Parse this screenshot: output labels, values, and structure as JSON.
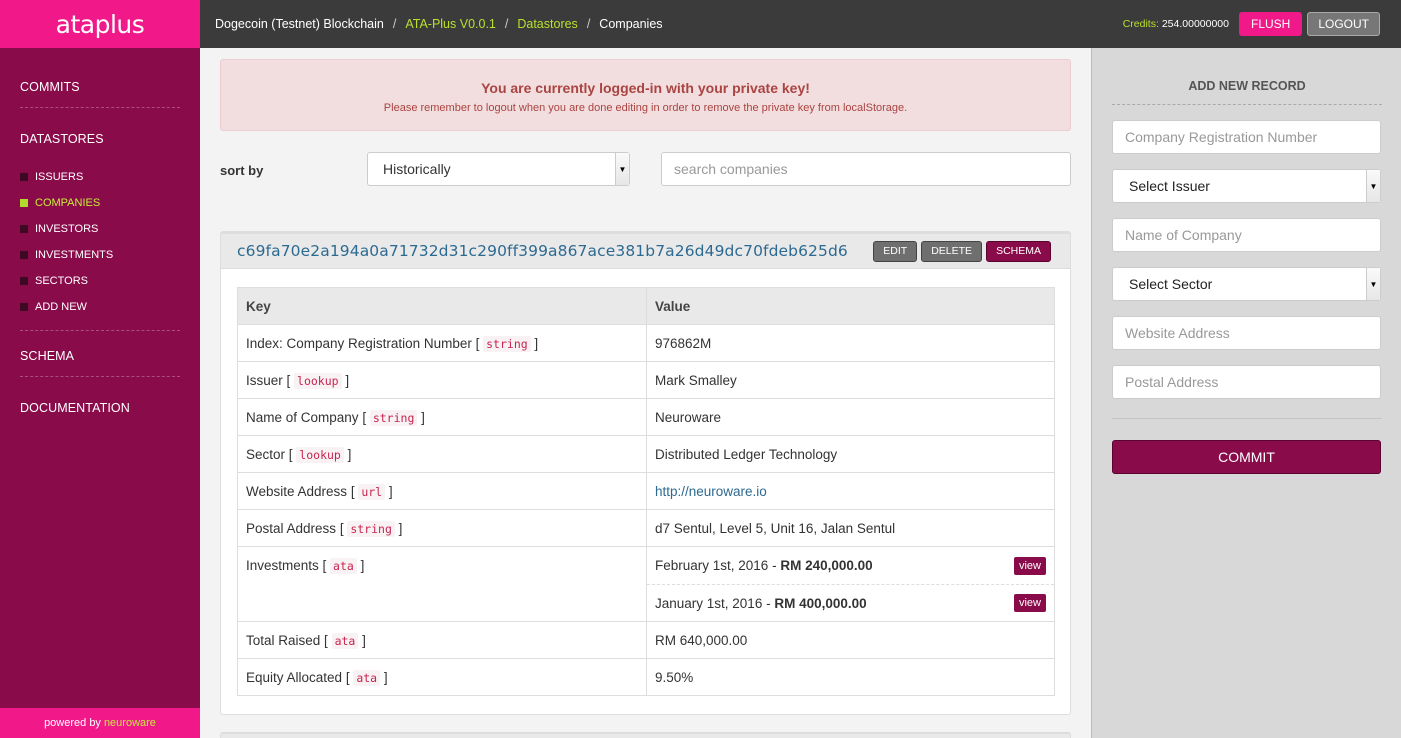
{
  "brand": {
    "name": "ataplus"
  },
  "sidebar": {
    "commits": "COMMITS",
    "datastores": "DATASTORES",
    "items": [
      {
        "label": "ISSUERS"
      },
      {
        "label": "COMPANIES"
      },
      {
        "label": "INVESTORS"
      },
      {
        "label": "INVESTMENTS"
      },
      {
        "label": "SECTORS"
      },
      {
        "label": "ADD NEW"
      }
    ],
    "schema": "SCHEMA",
    "documentation": "DOCUMENTATION",
    "footer_prefix": "powered by",
    "footer_brand": "neuroware"
  },
  "breadcrumb": [
    "Dogecoin (Testnet) Blockchain",
    "ATA-Plus V0.0.1",
    "Datastores",
    "Companies"
  ],
  "topbar": {
    "credits_label": "Credits:",
    "credits_value": "254.00000000",
    "flush": "FLUSH",
    "logout": "LOGOUT"
  },
  "alert": {
    "title": "You are currently logged-in with your private key!",
    "message": "Please remember to logout when you are done editing in order to remove the private key from localStorage."
  },
  "sort": {
    "label": "sort by",
    "selected": "Historically",
    "search_placeholder": "search companies"
  },
  "record": {
    "hash": "c69fa70e2a194a0a71732d31c290ff399a867ace381b7a26d49dc70fdeb625d6",
    "buttons": {
      "edit": "EDIT",
      "delete": "DELETE",
      "schema": "SCHEMA"
    },
    "headers": {
      "key": "Key",
      "value": "Value"
    },
    "rows": [
      {
        "key": "Index: Company Registration Number",
        "type": "string",
        "value": "976862M"
      },
      {
        "key": "Issuer",
        "type": "lookup",
        "value": "Mark Smalley"
      },
      {
        "key": "Name of Company",
        "type": "string",
        "value": "Neuroware"
      },
      {
        "key": "Sector",
        "type": "lookup",
        "value": "Distributed Ledger Technology"
      },
      {
        "key": "Website Address",
        "type": "url",
        "value": "http://neuroware.io"
      },
      {
        "key": "Postal Address",
        "type": "string",
        "value": "d7 Sentul, Level 5, Unit 16, Jalan Sentul"
      }
    ],
    "investments": {
      "key": "Investments",
      "type": "ata",
      "items": [
        {
          "date": "February 1st, 2016",
          "amount": "RM 240,000.00",
          "button": "view"
        },
        {
          "date": "January 1st, 2016",
          "amount": "RM 400,000.00",
          "button": "view"
        }
      ]
    },
    "rows2": [
      {
        "key": "Total Raised",
        "type": "ata",
        "value": "RM 640,000.00"
      },
      {
        "key": "Equity Allocated",
        "type": "ata",
        "value": "9.50%"
      }
    ]
  },
  "add_record": {
    "title": "ADD NEW RECORD",
    "fields": {
      "reg_number": "Company Registration Number",
      "issuer": "Select Issuer",
      "name": "Name of Company",
      "sector": "Select Sector",
      "website": "Website Address",
      "postal": "Postal Address"
    },
    "commit": "COMMIT"
  }
}
